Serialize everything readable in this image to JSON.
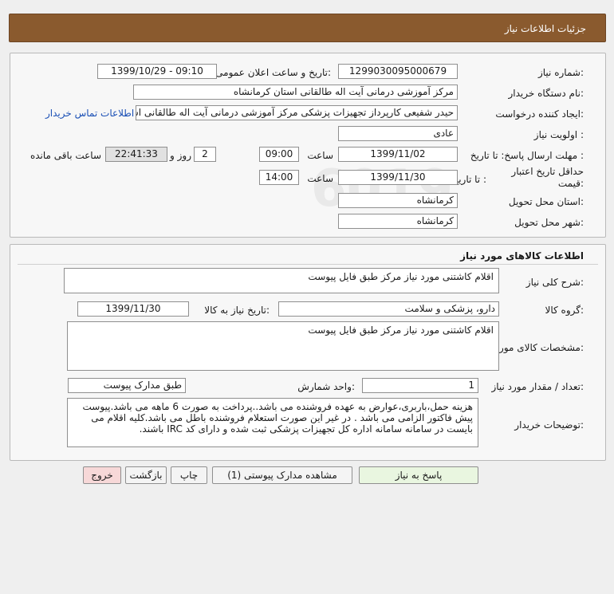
{
  "header": {
    "title": "جزئیات اطلاعات نیاز"
  },
  "general": {
    "need_number_label": "شماره نیاز:",
    "need_number": "1299030095000679",
    "announce_label": "تاریخ و ساعت اعلان عمومی:",
    "announce_value": "1399/10/29 - 09:10",
    "buyer_org_label": "نام دستگاه خریدار:",
    "buyer_org": "مرکز آموزشی درمانی آیت اله طالقانی استان کرمانشاه",
    "requester_label": "ایجاد کننده درخواست:",
    "requester": "حیدر شفیعی کارپرداز تجهیزات پزشکی مرکز آموزشی درمانی آیت اله طالقانی اس",
    "contact_link": "اطلاعات تماس خریدار",
    "priority_label": "اولویت نیاز :",
    "priority": "عادی",
    "deadline_label": "مهلت ارسال پاسخ: تا تاریخ :",
    "deadline_date": "1399/11/02",
    "time_label": "ساعت",
    "deadline_time": "09:00",
    "days_value": "2",
    "days_label": "روز و",
    "remaining_time": "22:41:33",
    "remaining_label": "ساعت باقی مانده",
    "validity_label": "حداقل تاریخ اعتبار قیمت:",
    "validity_to_label": "تا تاریخ :",
    "validity_date": "1399/11/30",
    "validity_time_label": "ساعت",
    "validity_time": "14:00",
    "province_label": "استان محل تحویل:",
    "province": "کرمانشاه",
    "city_label": "شهر محل تحویل:",
    "city": "کرمانشاه"
  },
  "goods": {
    "section_title": "اطلاعات کالاهای مورد نیاز",
    "desc_label": "شرح کلی نیاز:",
    "desc": "اقلام کاشتنی مورد نیاز مرکز طبق فایل پیوست",
    "group_label": "گروه کالا:",
    "group": "دارو، پزشکی و سلامت",
    "need_date_label": "تاریخ نیاز به کالا:",
    "need_date": "1399/11/30",
    "spec_label": "مشخصات کالای مورد نیاز:",
    "spec": "اقلام کاشتنی مورد نیاز مرکز طبق فایل پیوست",
    "qty_label": "تعداد / مقدار مورد نیاز:",
    "qty": "1",
    "unit_label": "واحد شمارش:",
    "unit": "طبق مدارک پیوست",
    "notes_label": "توضیحات خریدار:",
    "notes": "هزینه حمل،باربری،عوارض به عهده فروشنده می باشد..پرداخت به صورت 6 ماهه می باشد.پیوست پیش فاکتور الزامی می باشد . در غیر این صورت استعلام فروشنده باطل می باشد.کلیه اقلام می بایست در سامانه سامانه اداره کل تجهیزات پزشکی ثبت شده و دارای کد IRC باشند."
  },
  "buttons": {
    "reply": "پاسخ به نیاز",
    "view_docs": "مشاهده مدارک پیوستی (1)",
    "print": "چاپ",
    "back": "بازگشت",
    "exit": "خروج"
  },
  "colors": {
    "header_bg": "#8a5a2e",
    "page_bg": "#efefef",
    "panel_bg": "#f7f7f7",
    "reply_button_bg": "#e9f6e0",
    "exit_button_bg": "#f7d8d8",
    "link": "#1a4fb5"
  }
}
